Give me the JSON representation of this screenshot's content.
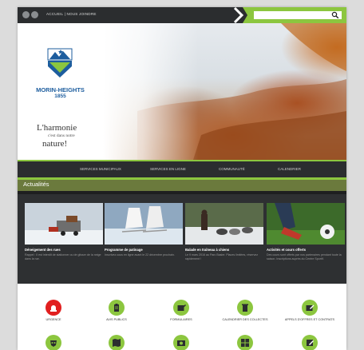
{
  "colors": {
    "accent": "#8cc63f",
    "dark": "#2b2d2f",
    "brand_blue": "#1d5d9e",
    "alert": "#e11f1f"
  },
  "topbar": {
    "links": "ACCUEIL | NOUS JOINDRE",
    "search_placeholder": ""
  },
  "hero": {
    "logo_name": "MORIN-HEIGHTS",
    "logo_year": "1855",
    "slogan_line1": "L'harmonie",
    "slogan_line2": "c'est dans notre",
    "slogan_line3": "nature!"
  },
  "nav": {
    "items": [
      "SERVICES MUNICIPAUX",
      "SERVICES EN LIGNE",
      "COMMUNAUTÉ",
      "CALENDRIER"
    ]
  },
  "news": {
    "heading": "Actualités",
    "cards": [
      {
        "title": "Déneigement des rues",
        "text": "Rappel : Il est interdit de stationner ou de glisser de la neige dans la rue."
      },
      {
        "title": "Programme de patinage",
        "text": "Inscrivez-vous en ligne avant le 22 décembre prochain."
      },
      {
        "title": "Balade en traîneau à chiens",
        "text": "Le 9 mars 2016 au Parc Basler. Places limitées, réservez rapidement !"
      },
      {
        "title": "Activités et cours offerts",
        "text": "Des cours sont offerts par nos partenaires pendant toute la saison. Inscriptions auprès du Centre Sportif."
      }
    ]
  },
  "quick_links": {
    "row1": [
      "URGENCE",
      "AVIS PUBLICS",
      "FORMULAIRES",
      "CALENDRIER DES COLLECTES",
      "APPELS D'OFFRES ET CONTRATS"
    ],
    "icons": [
      "alarm-icon",
      "clipboard-icon",
      "form-icon",
      "bin-icon",
      "contract-icon",
      "mask-icon",
      "map-icon",
      "camera-icon",
      "grid-icon",
      "note-icon"
    ]
  }
}
